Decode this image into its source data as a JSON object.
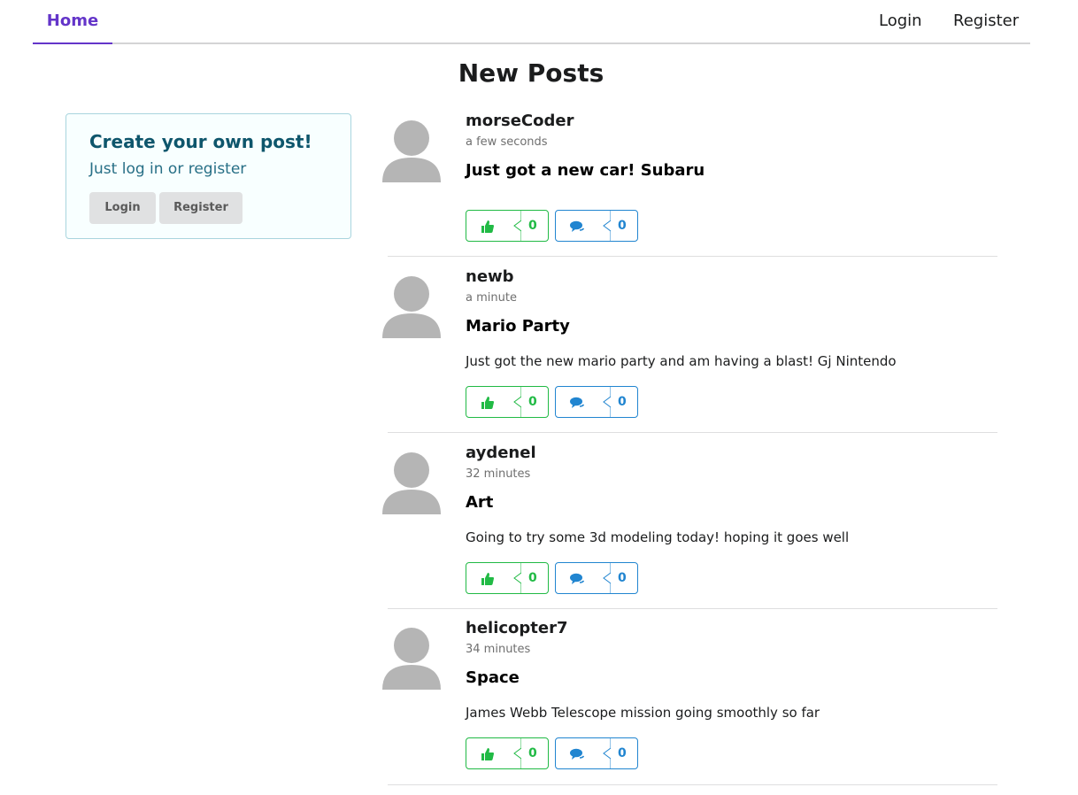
{
  "nav": {
    "home": "Home",
    "login": "Login",
    "register": "Register"
  },
  "page_title": "New Posts",
  "sidebar": {
    "heading": "Create your own post!",
    "subtext": "Just log in or register",
    "login_label": "Login",
    "register_label": "Register"
  },
  "posts": [
    {
      "user": "morseCoder",
      "time": "a few seconds",
      "title": "Just got a new car! Subaru",
      "body": "",
      "likes": "0",
      "comments": "0"
    },
    {
      "user": "newb",
      "time": "a minute",
      "title": "Mario Party",
      "body": "Just got the new mario party and am having a blast! Gj Nintendo",
      "likes": "0",
      "comments": "0"
    },
    {
      "user": "aydenel",
      "time": "32 minutes",
      "title": "Art",
      "body": "Going to try some 3d modeling today! hoping it goes well",
      "likes": "0",
      "comments": "0"
    },
    {
      "user": "helicopter7",
      "time": "34 minutes",
      "title": "Space",
      "body": "James Webb Telescope mission going smoothly so far",
      "likes": "0",
      "comments": "0"
    }
  ],
  "colors": {
    "accent": "#6435c9",
    "like": "#21ba45",
    "comment": "#2185d0",
    "avatar": "#b5b5b5"
  }
}
